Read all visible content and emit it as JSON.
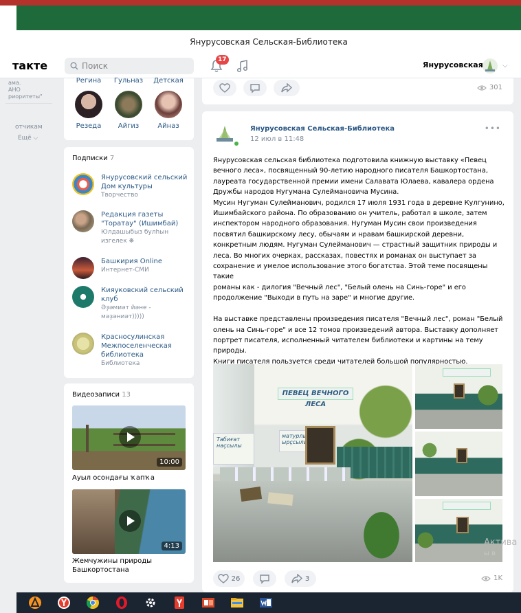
{
  "window": {
    "title": "Янурусовская Сельская-Библиотека"
  },
  "header": {
    "logo_text": "такте",
    "search_placeholder": "Поиск",
    "notifications_count": "17",
    "profile_name": "Янурусовская"
  },
  "left_nav": {
    "fragment_lines": [
      "ама.",
      "АНО",
      "риоритеты\""
    ],
    "item": "отчикам",
    "more": "Ещё"
  },
  "friends": {
    "cut_names": [
      "Регина",
      "Гульназ",
      "Детская"
    ],
    "items": [
      {
        "name": "Резеда"
      },
      {
        "name": "Айгиз"
      },
      {
        "name": "Айназ"
      }
    ]
  },
  "subscriptions": {
    "title": "Подписки",
    "count": "7",
    "items": [
      {
        "name": "Янурусовский сельский Дом культуры",
        "subtitle": "Творчество"
      },
      {
        "name": "Редакция газеты \"Торатау\" (Ишимбай)",
        "subtitle": "Юлдашыбыз булһын изгелек ❋"
      },
      {
        "name": "Башкирия Online",
        "subtitle": "Интернет-СМИ"
      },
      {
        "name": "Кияуковский сельский клуб",
        "subtitle": "Әҙәмиәт йәне - мәҙәниәт)))))"
      },
      {
        "name": "Красносулинская Межпоселенческая библиотека",
        "subtitle": "Библиотека"
      }
    ]
  },
  "videos": {
    "title": "Видеозаписи",
    "count": "13",
    "items": [
      {
        "title": "Ауыл осондағы ҡапҡа",
        "duration": "10:00"
      },
      {
        "title": "Жемчужины природы Башкортостана",
        "duration": "4:13"
      }
    ]
  },
  "prev_post": {
    "views": "301"
  },
  "post": {
    "author": "Янурусовская Сельская-Библиотека",
    "date": "12 июл в 11:48",
    "text": "Янурусовская сельская библиотека подготовила книжную выставку «Певец\nвечного леса», посвященный 90-летию народного писателя Башкортостана,\nлауреата государственной премии имени Салавата Юлаева, кавалера ордена\nДружбы народов Нугумана Сулеймановича Мусина.\nМусин Нугуман Сулейманович, родился 17 июля 1931 года в деревне Кулгунино,\nИшимбайского района. По образованию он учитель, работал в школе, затем\nинспектором народного образования. Нугуман Мусин свои произведения\nпосвятил башкирскому лесу, обычаям и нравам башкирской деревни,\nконкретным людям. Нугуман Сулейманович — страстный защитник природы и\nлеса. Во многих очерках, рассказах, повестях и романах он выступает за\nсохранение и умелое использование этого богатства. Этой теме посвящены такие\nроманы как - дилогия \"Вечный лес\", \"Белый олень на Синь-горе\" и его\nпродолжение \"Выходи в путь на заре\" и многие другие.\n\nНа выставке представлены произведения писателя \"Вечный лес\", роман \"Белый\nолень на Синь-горе\" и все 12 томов произведений автора. Выставку дополняет\nпортрет писателя, исполненный читателем библиотеки и картины на тему\nприроды.\nКниги писателя пользуется среди читателей большой популярностью.",
    "photo_banner": "ПЕВЕЦ ВЕЧНОГО ЛЕСА",
    "photo_sign_left": "Табиғат\nнаҫсылы",
    "photo_sign_right": "матурлыҡ\nырҫсылы",
    "likes": "26",
    "shares": "3",
    "views": "1K"
  },
  "watermark": {
    "line1": "Актива",
    "line2": "ы в"
  },
  "taskbar": {
    "icons": [
      "avast-icon",
      "yandex-browser-icon",
      "chrome-icon",
      "opera-icon",
      "settings-gear-icon",
      "yandex-icon",
      "powerpoint-icon",
      "file-explorer-icon",
      "word-icon"
    ]
  },
  "colors": {
    "link": "#2a5885",
    "brand_green": "#1e6a3a",
    "band_red": "#b5322c",
    "badge": "#e64646",
    "taskbar": "#1b2431"
  }
}
